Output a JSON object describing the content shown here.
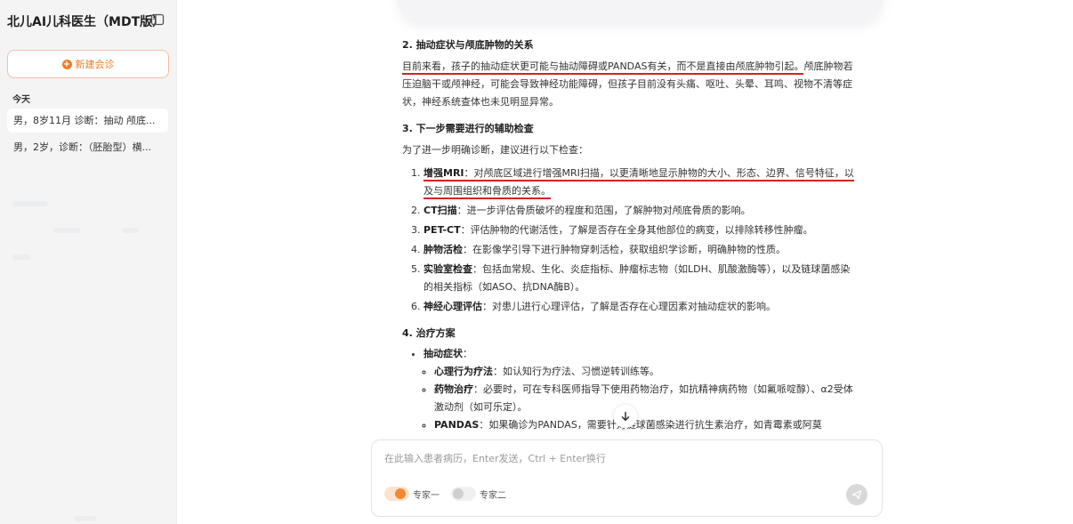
{
  "sidebar": {
    "title": "北儿AI儿科医生（MDT版）",
    "new_button_label": "新建会诊",
    "section_today": "今天",
    "items": [
      {
        "label": "男，8岁11月 诊断：抽动 颅底..."
      },
      {
        "label": "男，2岁，诊断：（胚胎型）横..."
      }
    ]
  },
  "content": {
    "section2_title": "2. 抽动症状与颅底肿物的关系",
    "section2_underlined": "目前来看，孩子的抽动症状更可能与抽动障碍或PANDAS有关，而不是直接由颅底肿物引起。",
    "section2_rest": "颅底肿物若压迫脑干或颅神经，可能会导致神经功能障碍，但孩子目前没有头痛、呕吐、头晕、耳鸣、视物不清等症状，神经系统查体也未见明显异常。",
    "section3_title": "3. 下一步需要进行的辅助检查",
    "section3_intro": "为了进一步明确诊断，建议进行以下检查：",
    "checks": [
      {
        "term": "增强MRI",
        "desc": "：对颅底区域进行增强MRI扫描，以更清晰地显示肿物的大小、形态、边界、信号特征，以及与周围组织和骨质的关系。"
      },
      {
        "term": "CT扫描",
        "desc": "：进一步评估骨质破坏的程度和范围，了解肿物对颅底骨质的影响。"
      },
      {
        "term": "PET-CT",
        "desc": "：评估肿物的代谢活性，了解是否存在全身其他部位的病变，以排除转移性肿瘤。"
      },
      {
        "term": "肿物活检",
        "desc": "：在影像学引导下进行肿物穿刺活检，获取组织学诊断，明确肿物的性质。"
      },
      {
        "term": "实验室检查",
        "desc": "：包括血常规、生化、炎症指标、肿瘤标志物（如LDH、肌酸激酶等），以及链球菌感染的相关指标（如ASO、抗DNA酶B）。"
      },
      {
        "term": "神经心理评估",
        "desc": "：对患儿进行心理评估，了解是否存在心理因素对抽动症状的影响。"
      }
    ],
    "section4_title": "4. 治疗方案",
    "bullet1_term": "抽动症状",
    "bullet1_colon": "：",
    "treatments": [
      {
        "term": "心理行为疗法",
        "desc": "：如认知行为疗法、习惯逆转训练等。"
      },
      {
        "term": "药物治疗",
        "desc": "：必要时，可在专科医师指导下使用药物治疗，如抗精神病药物（如氟哌啶醇）、α2受体激动剂（如可乐定）。"
      },
      {
        "term": "PANDAS",
        "desc": "：如果确诊为PANDAS，需要针对链球菌感染进行抗生素治疗，如青霉素或阿莫"
      }
    ]
  },
  "input": {
    "placeholder": "在此输入患者病历，Enter发送，Ctrl + Enter换行",
    "value": "",
    "expert1_label": "专家一",
    "expert2_label": "专家二",
    "expert1_on": true,
    "expert2_on": false
  },
  "colors": {
    "accent": "#ee7d28",
    "underline": "#d6211f"
  },
  "icons": {
    "collapse": "sidebar-collapse-icon",
    "new": "plus-circle-icon",
    "scroll_down": "arrow-down-icon",
    "send": "send-icon"
  }
}
